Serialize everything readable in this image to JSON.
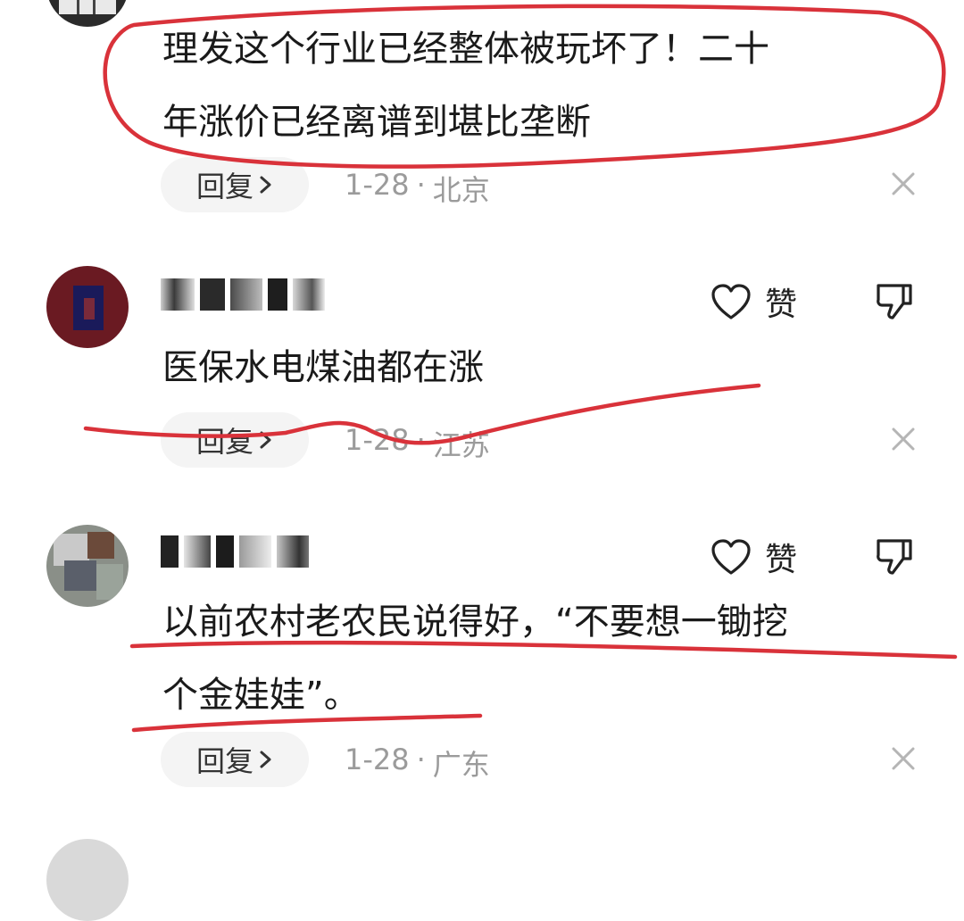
{
  "comments": [
    {
      "text_lines": [
        "理发这个行业已经整体被玩坏了！二十",
        "年涨价已经离谱到堪比垄断"
      ],
      "reply_label": "回复",
      "date": "1-28",
      "separator": "·",
      "location": "北京"
    },
    {
      "text_lines": [
        "医保水电煤油都在涨"
      ],
      "like_label": "赞",
      "reply_label": "回复",
      "date": "1-28",
      "separator": "·",
      "location": "江苏"
    },
    {
      "text_lines": [
        "以前农村老农民说得好，“不要想一锄挖",
        "个金娃娃”。"
      ],
      "like_label": "赞",
      "reply_label": "回复",
      "date": "1-28",
      "separator": "·",
      "location": "广东"
    }
  ],
  "icons": [
    "heart-outline-icon",
    "thumb-down-icon",
    "close-icon",
    "chevron-right-icon"
  ],
  "colors": {
    "annotation_red": "#d9323a",
    "meta_gray": "#9b9b9b",
    "reply_bg": "#f4f4f4"
  }
}
